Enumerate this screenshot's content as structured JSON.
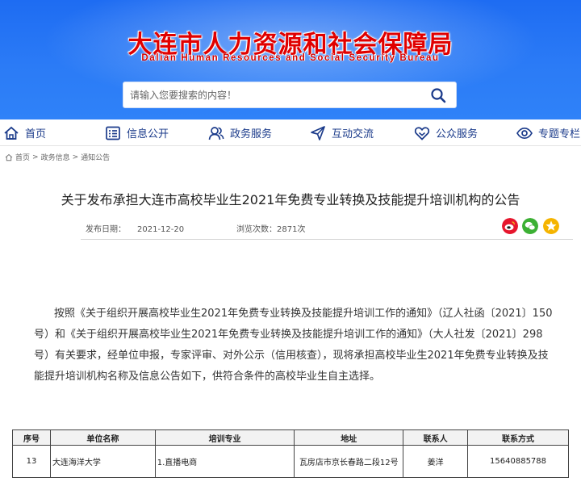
{
  "header": {
    "title": "大连市人力资源和社会保障局",
    "subtitle": "Dalian Human Resources and Social Security Bureau",
    "bg_color": "#2b7bf6",
    "title_color": "#e00000"
  },
  "search": {
    "placeholder": "请输入您要搜索的内容！",
    "icon": "search-icon"
  },
  "nav": {
    "items": [
      {
        "label": "首页",
        "icon": "home-icon"
      },
      {
        "label": "信息公开",
        "icon": "list-icon"
      },
      {
        "label": "政务服务",
        "icon": "people-icon"
      },
      {
        "label": "互动交流",
        "icon": "send-icon"
      },
      {
        "label": "公众服务",
        "icon": "heart-icon"
      },
      {
        "label": "专题专栏",
        "icon": "eye-icon"
      }
    ]
  },
  "breadcrumb": {
    "items": [
      "首页",
      "政务信息",
      "通知公告"
    ],
    "separator": ">"
  },
  "article": {
    "title": "关于发布承担大连市高校毕业生2021年免费专业转换及技能提升培训机构的公告",
    "publish_label": "发布日期：",
    "publish_date": "2021-12-20",
    "views_label": "浏览次数：",
    "views": "2871次",
    "share": [
      "weibo-icon",
      "wechat-icon",
      "qzone-icon"
    ],
    "body": "按照《关于组织开展高校毕业生2021年免费专业转换及技能提升培训工作的通知》（辽人社函〔2021〕150号）和《关于组织开展高校毕业生2021年免费专业转换及技能提升培训工作的通知》（大人社发〔2021〕298号）有关要求，经单位申报，专家评审、对外公示（信用核查），现将承担高校毕业生2021年免费专业转换及技能提升培训机构名称及信息公告如下，供符合条件的高校毕业生自主选择。"
  },
  "table": {
    "headers": [
      "序号",
      "单位名称",
      "培训专业",
      "地址",
      "联系人",
      "联系方式"
    ],
    "rows": [
      [
        "13",
        "大连海洋大学",
        "1.直播电商",
        "瓦房店市京长春路二段12号",
        "姜洋",
        "15640885788"
      ]
    ]
  }
}
